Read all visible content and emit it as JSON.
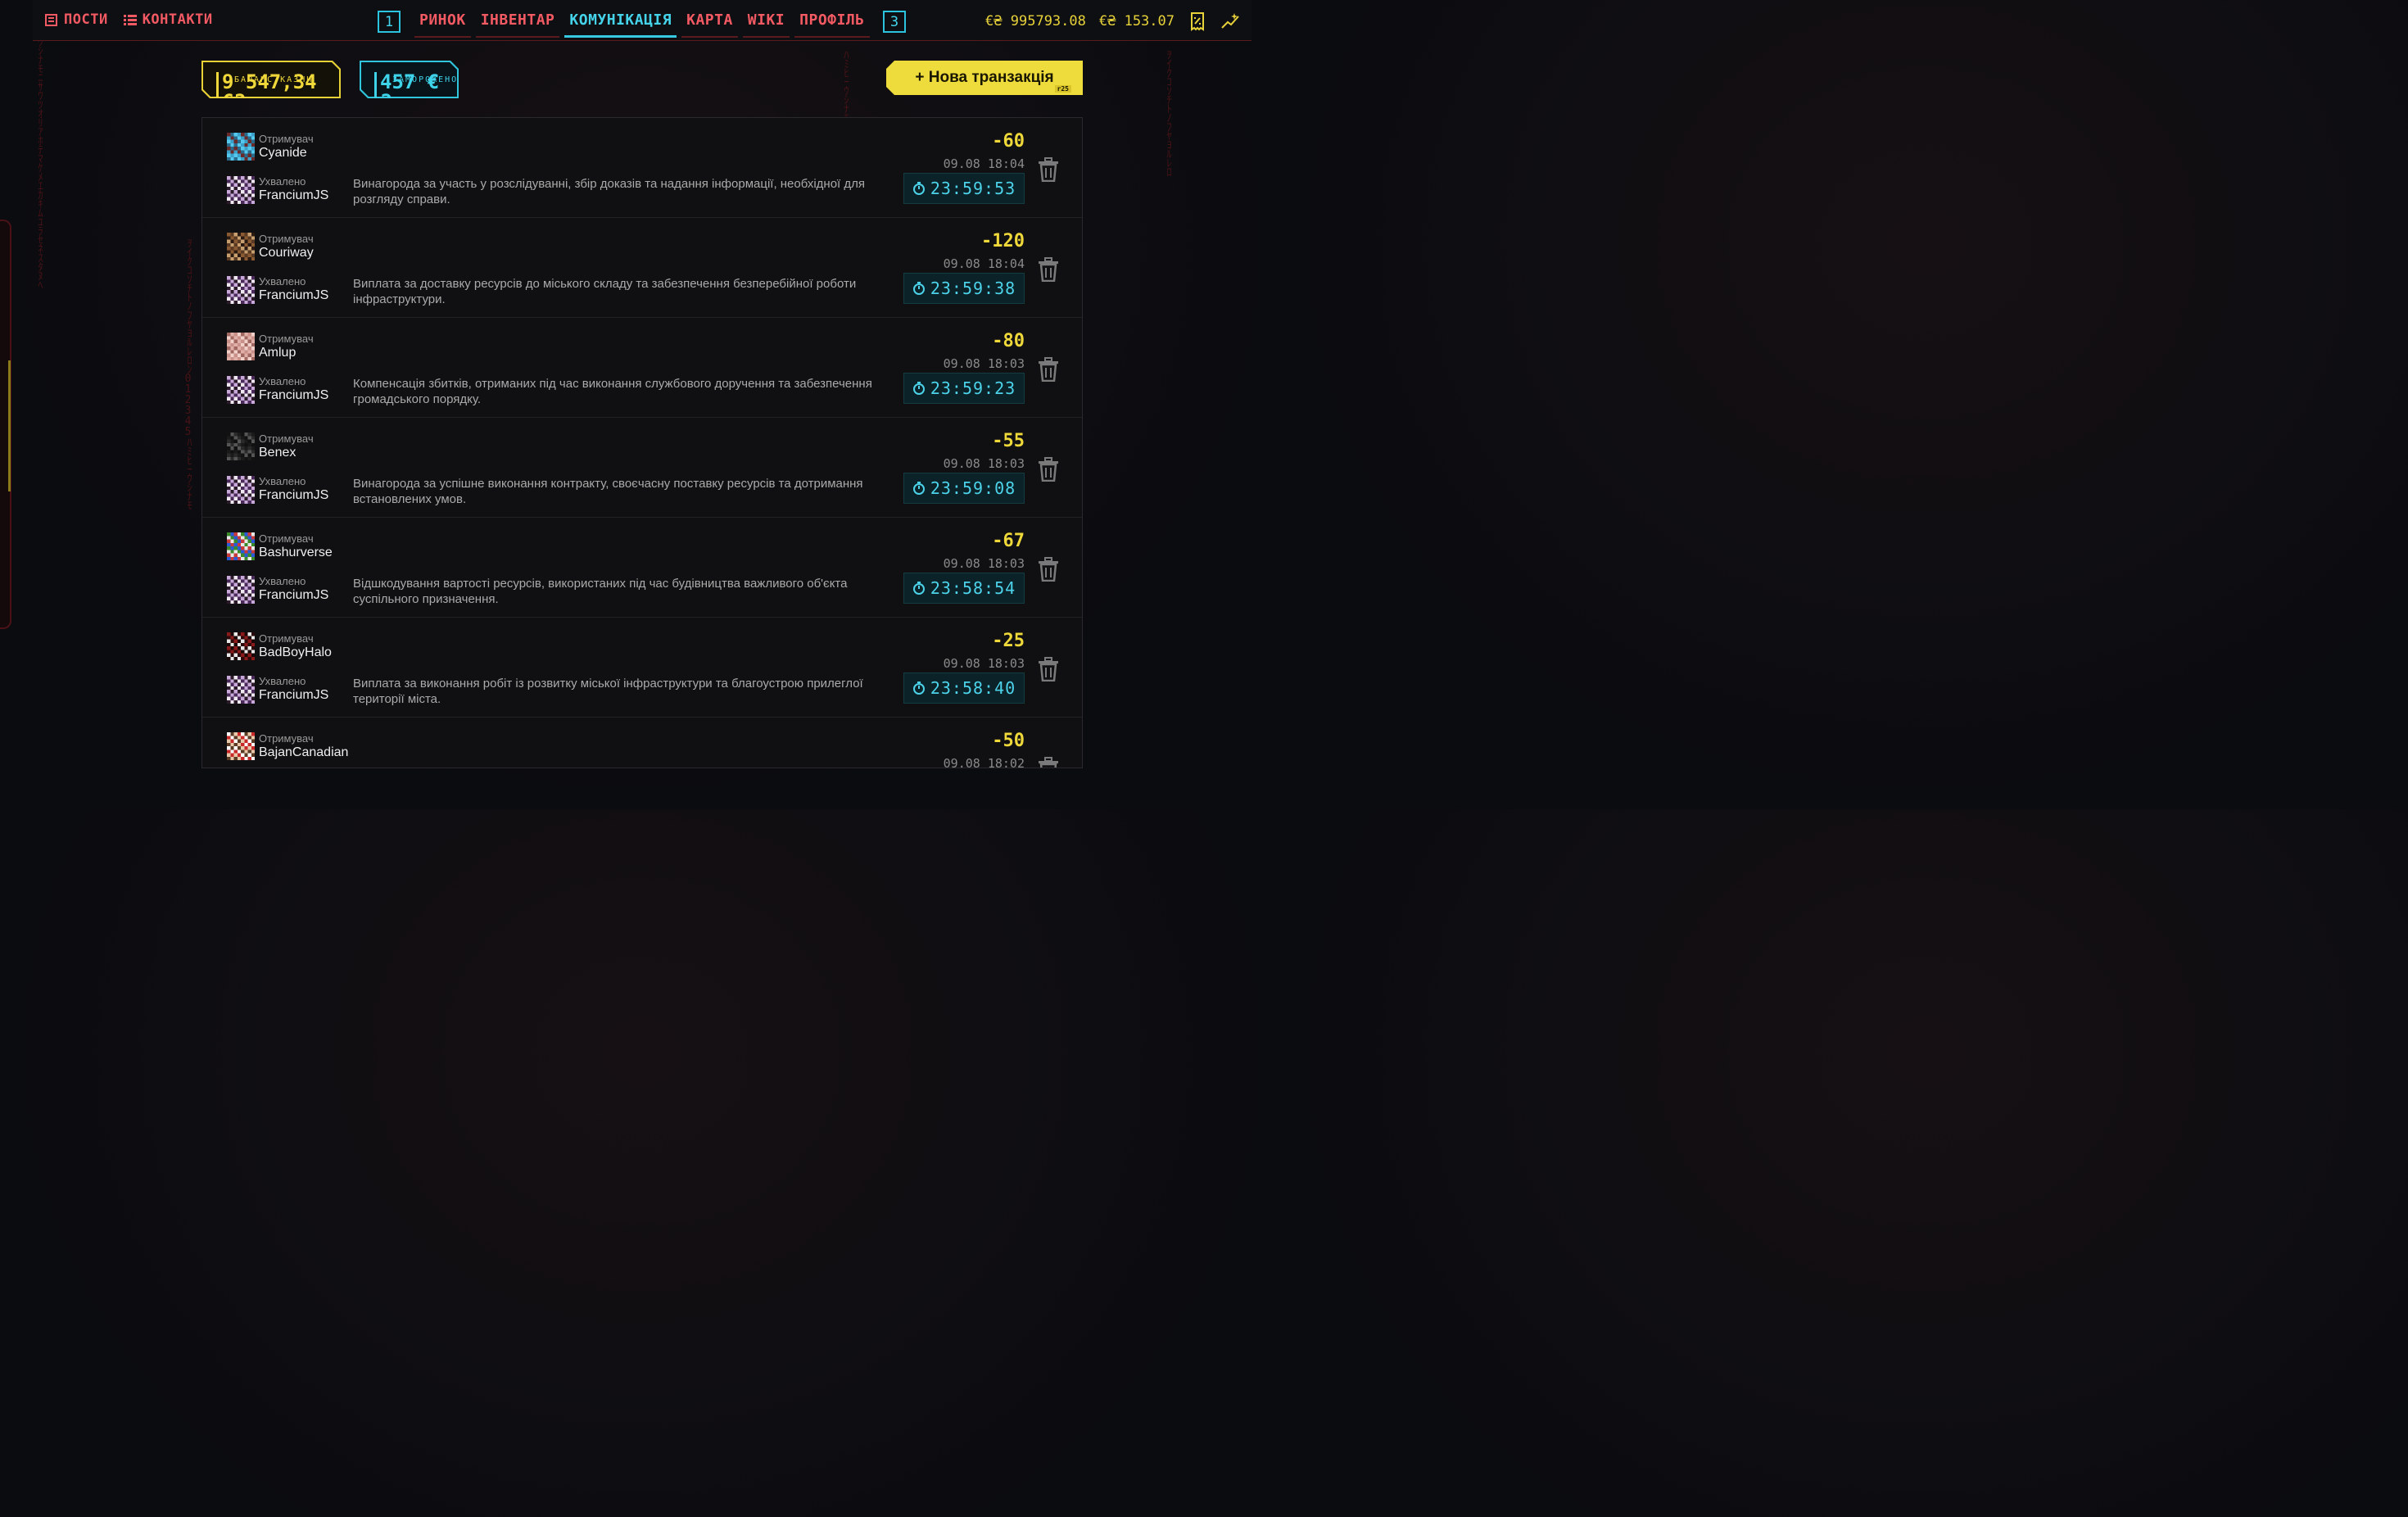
{
  "topbar": {
    "links": [
      {
        "label": "ПОСТИ",
        "icon": "newspaper-icon"
      },
      {
        "label": "КОНТАКТИ",
        "icon": "list-icon"
      }
    ],
    "key_left": "1",
    "key_right": "3",
    "tabs": [
      {
        "label": "РИНОК",
        "active": false
      },
      {
        "label": "ІНВЕНТАР",
        "active": false
      },
      {
        "label": "КОМУНІКАЦІЯ",
        "active": true
      },
      {
        "label": "КАРТА",
        "active": false
      },
      {
        "label": "WIKI",
        "active": false
      },
      {
        "label": "ПРОФІЛЬ",
        "active": false
      }
    ],
    "balance_main": "€₴ 995793.08",
    "balance_second": "€₴ 153.07"
  },
  "treasury": {
    "label": "БАЛАНС КАЗНИ",
    "value": "9 547,34 €₴"
  },
  "frozen": {
    "label": "ЗАМОРОЖЕНО",
    "value": "457 €₴"
  },
  "new_transaction": {
    "label": "+ Нова транзакція",
    "tag": "r25"
  },
  "captions": {
    "recipient": "Отримувач",
    "approved": "Ухвалено"
  },
  "transactions": [
    {
      "recipient": "Cyanide",
      "approver": "FranciumJS",
      "description": "Винагорода за участь у розслідуванні, збір доказів та надання інформації, необхідної для розгляду справи.",
      "amount": "-60",
      "date": "09.08 18:04",
      "timer": "23:59:53"
    },
    {
      "recipient": "Couriway",
      "approver": "FranciumJS",
      "description": "Виплата за доставку ресурсів до міського складу та забезпечення безперебійної роботи інфраструктури.",
      "amount": "-120",
      "date": "09.08 18:04",
      "timer": "23:59:38"
    },
    {
      "recipient": "Amlup",
      "approver": "FranciumJS",
      "description": "Компенсація збитків, отриманих під час виконання службового доручення та забезпечення громадського порядку.",
      "amount": "-80",
      "date": "09.08 18:03",
      "timer": "23:59:23"
    },
    {
      "recipient": "Benex",
      "approver": "FranciumJS",
      "description": "Винагорода за успішне виконання контракту, своєчасну поставку ресурсів та дотримання встановлених умов.",
      "amount": "-55",
      "date": "09.08 18:03",
      "timer": "23:59:08"
    },
    {
      "recipient": "Bashurverse",
      "approver": "FranciumJS",
      "description": "Відшкодування вартості ресурсів, використаних під час будівництва важливого об'єкта суспільного призначення.",
      "amount": "-67",
      "date": "09.08 18:03",
      "timer": "23:58:54"
    },
    {
      "recipient": "BadBoyHalo",
      "approver": "FranciumJS",
      "description": "Виплата за виконання робіт із розвитку міської інфраструктури та благоустрою прилеглої території міста.",
      "amount": "-25",
      "date": "09.08 18:03",
      "timer": "23:58:40"
    },
    {
      "recipient": "BajanCanadian",
      "approver": "",
      "description": "",
      "amount": "-50",
      "date": "09.08 18:02",
      "timer": ""
    }
  ],
  "colors": {
    "accent_red": "#f35a63",
    "accent_cyan": "#45d3ea",
    "accent_yellow": "#efd83a"
  }
}
